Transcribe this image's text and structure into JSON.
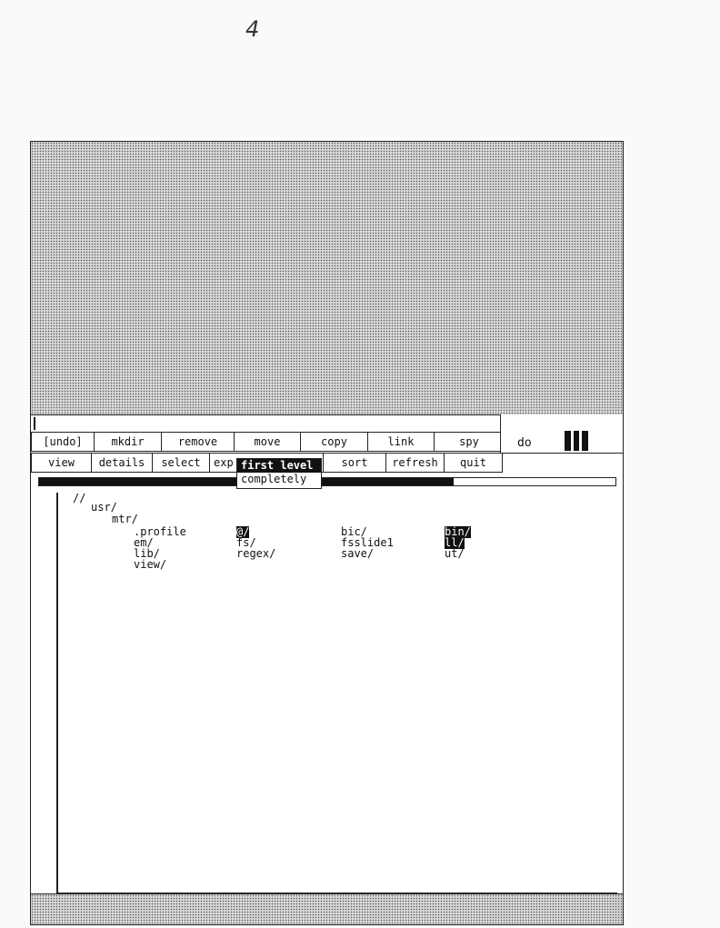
{
  "page_number": "4",
  "command_line": {
    "value": ""
  },
  "menu": {
    "row1": [
      "[undo]",
      "mkdir",
      "remove",
      "move",
      "copy",
      "link",
      "spy"
    ],
    "row2": [
      "view",
      "details",
      "select",
      "exp",
      "sort",
      "refresh",
      "quit"
    ],
    "do_label": "do"
  },
  "popup": {
    "items": [
      "first level",
      "completely"
    ],
    "selected": "first level"
  },
  "progress": {
    "fraction": 0.72
  },
  "tree": {
    "root": "//",
    "level1": "usr/",
    "level2": "mtr/",
    "columns": [
      [
        ".profile",
        "em/",
        "lib/",
        "view/"
      ],
      [
        "@/",
        "fs/",
        "regex/"
      ],
      [
        "bic/",
        "fsslide1",
        "save/"
      ],
      [
        "bin/",
        "ll/",
        "ut/"
      ]
    ],
    "highlighted": [
      "@/",
      "bin/",
      "ll/"
    ]
  },
  "colors": {
    "background": "#ffffff",
    "foreground": "#111111",
    "stipple": "#d8d8d8"
  }
}
